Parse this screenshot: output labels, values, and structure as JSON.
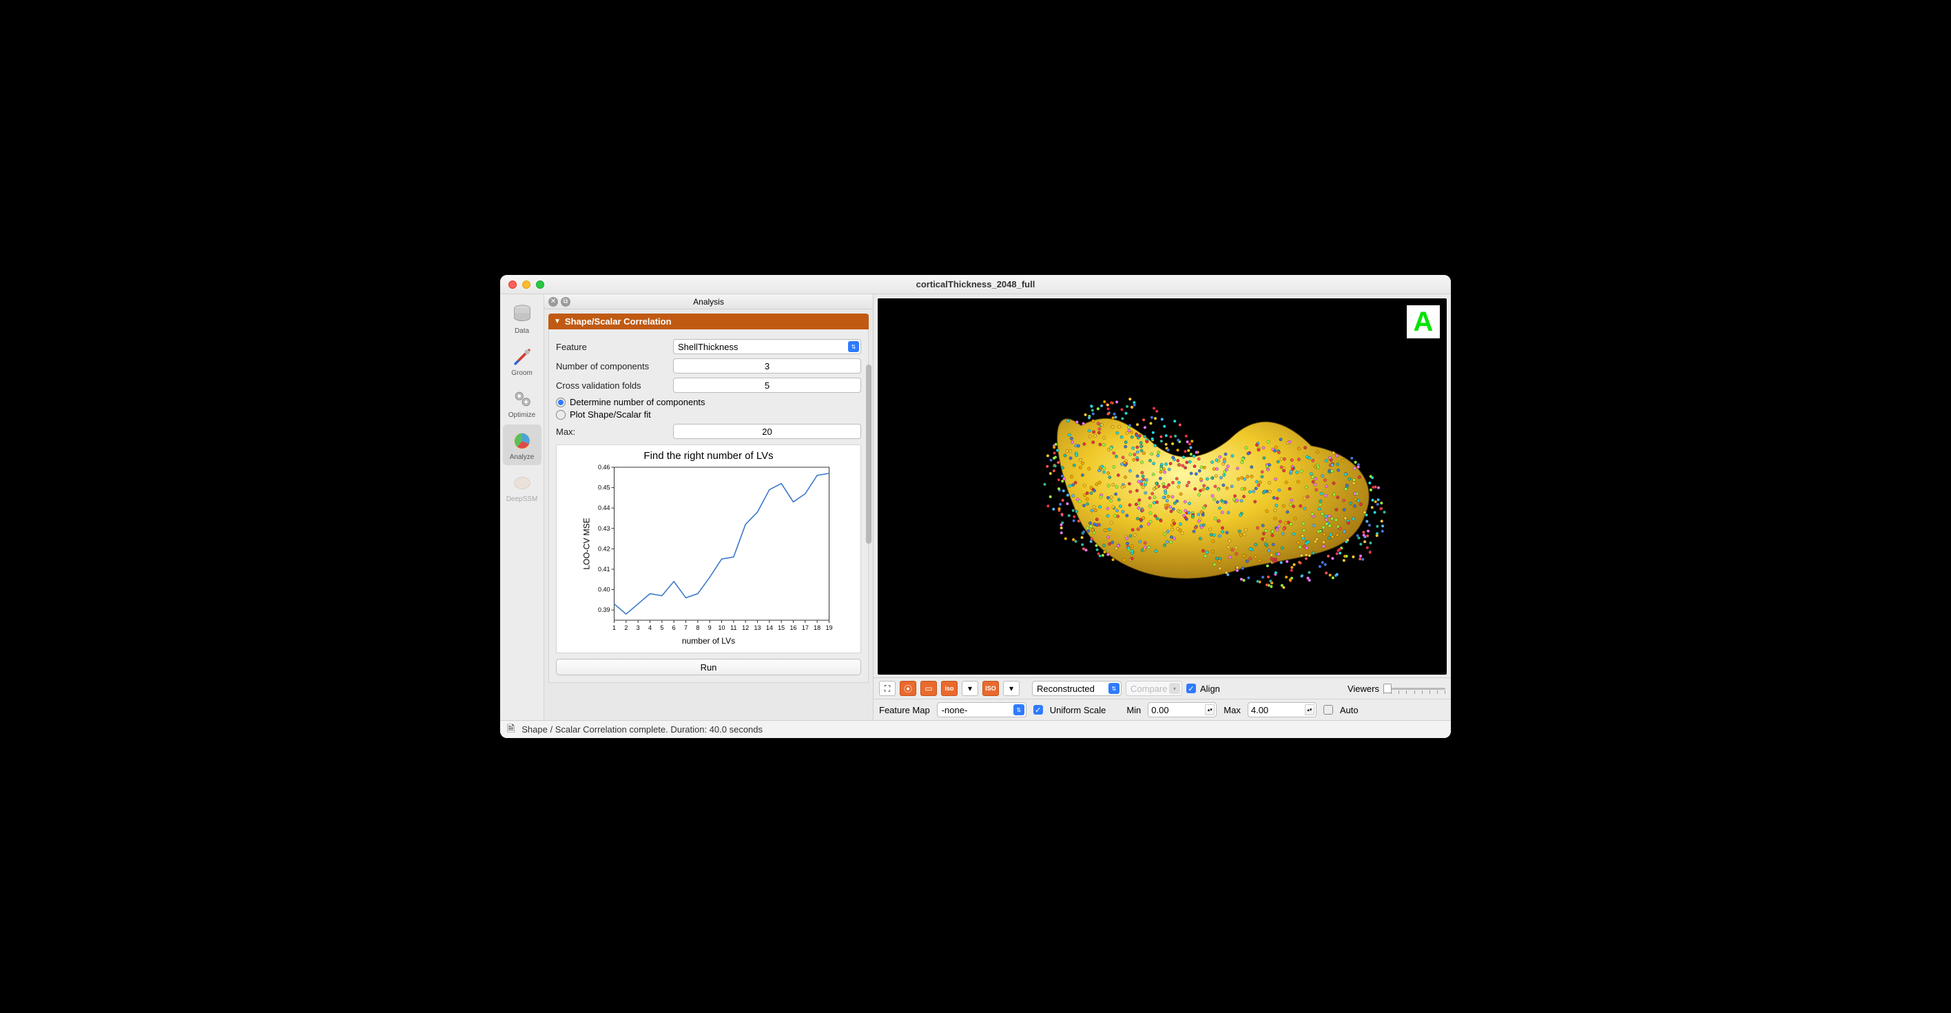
{
  "window": {
    "title": "corticalThickness_2048_full"
  },
  "sidebar": {
    "items": [
      {
        "label": "Data"
      },
      {
        "label": "Groom"
      },
      {
        "label": "Optimize"
      },
      {
        "label": "Analyze"
      },
      {
        "label": "DeepSSM"
      }
    ]
  },
  "panel": {
    "title": "Analysis",
    "section_title": "Shape/Scalar Correlation",
    "feature_label": "Feature",
    "feature_value": "ShellThickness",
    "num_components_label": "Number of components",
    "num_components_value": "3",
    "cv_folds_label": "Cross validation folds",
    "cv_folds_value": "5",
    "radio_determine": "Determine number of components",
    "radio_plot": "Plot Shape/Scalar fit",
    "max_label": "Max:",
    "max_value": "20",
    "run_label": "Run"
  },
  "chart_data": {
    "type": "line",
    "title": "Find the right number of LVs",
    "xlabel": "number of LVs",
    "ylabel": "LOO-CV MSE",
    "x_ticks": [
      "1",
      "2",
      "3",
      "4",
      "5",
      "6",
      "7",
      "8",
      "9",
      "10",
      "11",
      "12",
      "13",
      "14",
      "15",
      "16",
      "17",
      "18",
      "19"
    ],
    "y_ticks": [
      "0.39",
      "0.40",
      "0.41",
      "0.42",
      "0.43",
      "0.44",
      "0.45",
      "0.46"
    ],
    "xlim": [
      1,
      19
    ],
    "ylim": [
      0.385,
      0.46
    ],
    "x": [
      1,
      2,
      3,
      4,
      5,
      6,
      7,
      8,
      9,
      10,
      11,
      12,
      13,
      14,
      15,
      16,
      17,
      18,
      19
    ],
    "y": [
      0.393,
      0.388,
      0.393,
      0.398,
      0.397,
      0.404,
      0.396,
      0.398,
      0.406,
      0.415,
      0.416,
      0.432,
      0.438,
      0.449,
      0.452,
      0.443,
      0.447,
      0.456,
      0.457
    ]
  },
  "viewer": {
    "corner_label": "A"
  },
  "toolbar": {
    "reconstructed_label": "Reconstructed",
    "compare_label": "Compare",
    "align_label": "Align",
    "viewers_label": "Viewers"
  },
  "bottombar": {
    "featuremap_label": "Feature Map",
    "featuremap_value": "-none-",
    "uniform_scale_label": "Uniform Scale",
    "min_label": "Min",
    "min_value": "0.00",
    "max_label": "Max",
    "max_value": "4.00",
    "auto_label": "Auto"
  },
  "status": {
    "text": "Shape / Scalar Correlation complete.  Duration: 40.0 seconds"
  }
}
